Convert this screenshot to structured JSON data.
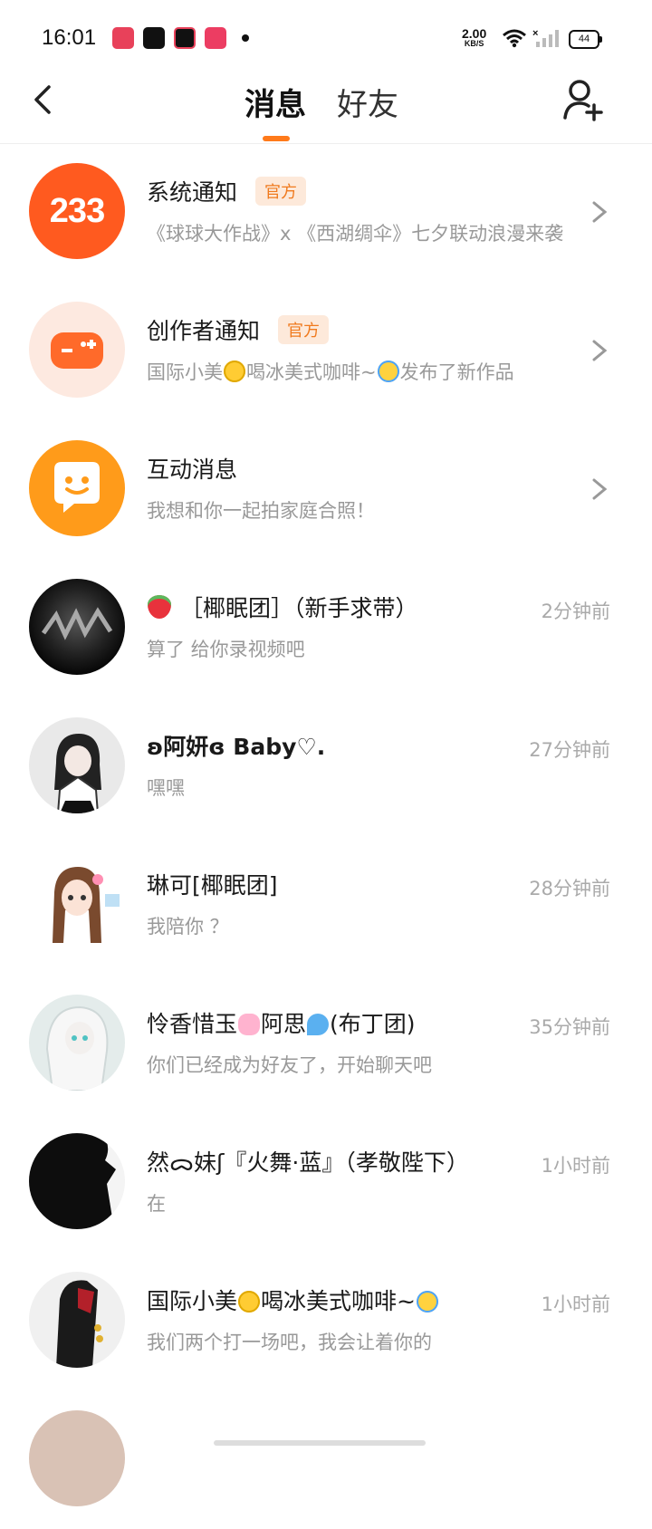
{
  "status_bar": {
    "time": "16:01",
    "net_speed_value": "2.00",
    "net_speed_unit": "KB/S",
    "battery": "44"
  },
  "header": {
    "tabs": [
      {
        "label": "消息",
        "active": true
      },
      {
        "label": "好友",
        "active": false
      }
    ],
    "accent_color": "#ff7a1a"
  },
  "items": [
    {
      "name": "系统通知",
      "badge": "官方",
      "preview": "《球球大作战》x 《西湖绸伞》七夕联动浪漫来袭",
      "time": "",
      "avatar_text": "233",
      "avatar_color": "#ff5a1f"
    },
    {
      "name": "创作者通知",
      "badge": "官方",
      "preview_parts": [
        "国际小美",
        "喝冰美式咖啡~",
        "发布了新作品"
      ],
      "time": "",
      "avatar_color": "#fde9e0"
    },
    {
      "name": "互动消息",
      "preview": "我想和你一起拍家庭合照！",
      "time": "",
      "avatar_color": "#ff9b1a"
    },
    {
      "name": "［椰眠团］（新手求带）",
      "preview": "算了 给你录视频吧",
      "time": "2分钟前"
    },
    {
      "name": "ʚ阿妍ɞ  Baby♡.",
      "preview": "嘿嘿",
      "time": "27分钟前"
    },
    {
      "name": "琳可[椰眠团]",
      "preview": "我陪你 ？",
      "time": "28分钟前"
    },
    {
      "name_parts": [
        "怜香惜玉",
        "阿思",
        "(布丁团)"
      ],
      "preview": "你们已经成为好友了，开始聊天吧",
      "time": "35分钟前"
    },
    {
      "name": "然ᯅ妹ʃ『火舞·蓝』（孝敬陛下）",
      "preview": "在",
      "time": "1小时前"
    },
    {
      "name_parts": [
        "国际小美",
        "喝冰美式咖啡~"
      ],
      "preview": "我们两个打一场吧，我会让着你的",
      "time": "1小时前"
    }
  ]
}
